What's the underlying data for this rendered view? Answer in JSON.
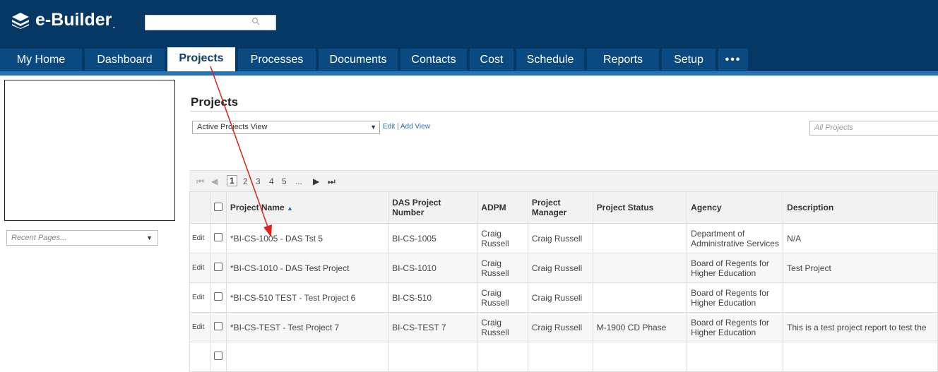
{
  "app": {
    "logo_text": "e-Builder",
    "logo_dot": ".",
    "search_placeholder": ""
  },
  "nav": {
    "items": [
      {
        "label": "My Home"
      },
      {
        "label": "Dashboard"
      },
      {
        "label": "Projects",
        "active": true
      },
      {
        "label": "Processes"
      },
      {
        "label": "Documents"
      },
      {
        "label": "Contacts"
      },
      {
        "label": "Cost"
      },
      {
        "label": "Schedule"
      },
      {
        "label": "Reports"
      },
      {
        "label": "Setup"
      },
      {
        "label": "•••"
      }
    ]
  },
  "sidebar": {
    "recent_placeholder": "Recent Pages..."
  },
  "page": {
    "title": "Projects",
    "view_select": "Active Projects View",
    "edit_link": "Edit",
    "link_separator": "|",
    "add_view_link": "Add View",
    "filter_placeholder": "All Projects"
  },
  "pager": {
    "first": "⏮",
    "prev": "◀",
    "pages": [
      "1",
      "2",
      "3",
      "4",
      "5"
    ],
    "ellipsis": "...",
    "next": "▶",
    "last": "⏭"
  },
  "table": {
    "columns": [
      "Project Name",
      "DAS Project Number",
      "ADPM",
      "Project Manager",
      "Project Status",
      "Agency",
      "Description"
    ],
    "sort_indicator": "▲",
    "edit_label": "Edit",
    "rows": [
      {
        "name": "*BI-CS-1005 - DAS Tst 5",
        "number": "BI-CS-1005",
        "adpm": "Craig Russell",
        "manager": "Craig Russell",
        "status": "",
        "agency": "Department of Administrative Services",
        "description": "N/A"
      },
      {
        "name": "*BI-CS-1010 - DAS Test Project",
        "number": "BI-CS-1010",
        "adpm": "Craig Russell",
        "manager": "Craig Russell",
        "status": "",
        "agency": "Board of Regents for Higher Education",
        "description": "Test Project"
      },
      {
        "name": "*BI-CS-510 TEST - Test Project 6",
        "number": "BI-CS-510",
        "adpm": "Craig Russell",
        "manager": "Craig Russell",
        "status": "",
        "agency": "Board of Regents for Higher Education",
        "description": ""
      },
      {
        "name": "*BI-CS-TEST - Test Project 7",
        "number": "BI-CS-TEST 7",
        "adpm": "Craig Russell",
        "manager": "Craig Russell",
        "status": "M-1900 CD Phase",
        "agency": "Board of Regents for Higher Education",
        "description": "This is a test project report to test the"
      }
    ]
  },
  "colors": {
    "header_bg": "#063866",
    "accent": "#2874b8",
    "link": "#2a6cb0",
    "annotation_arrow": "#e0201a"
  },
  "icons": [
    "logo-icon",
    "search-icon",
    "dropdown-caret-icon",
    "first-page-icon",
    "prev-page-icon",
    "next-page-icon",
    "last-page-icon",
    "sort-asc-icon",
    "checkbox-icon",
    "annotation-arrow-icon"
  ]
}
